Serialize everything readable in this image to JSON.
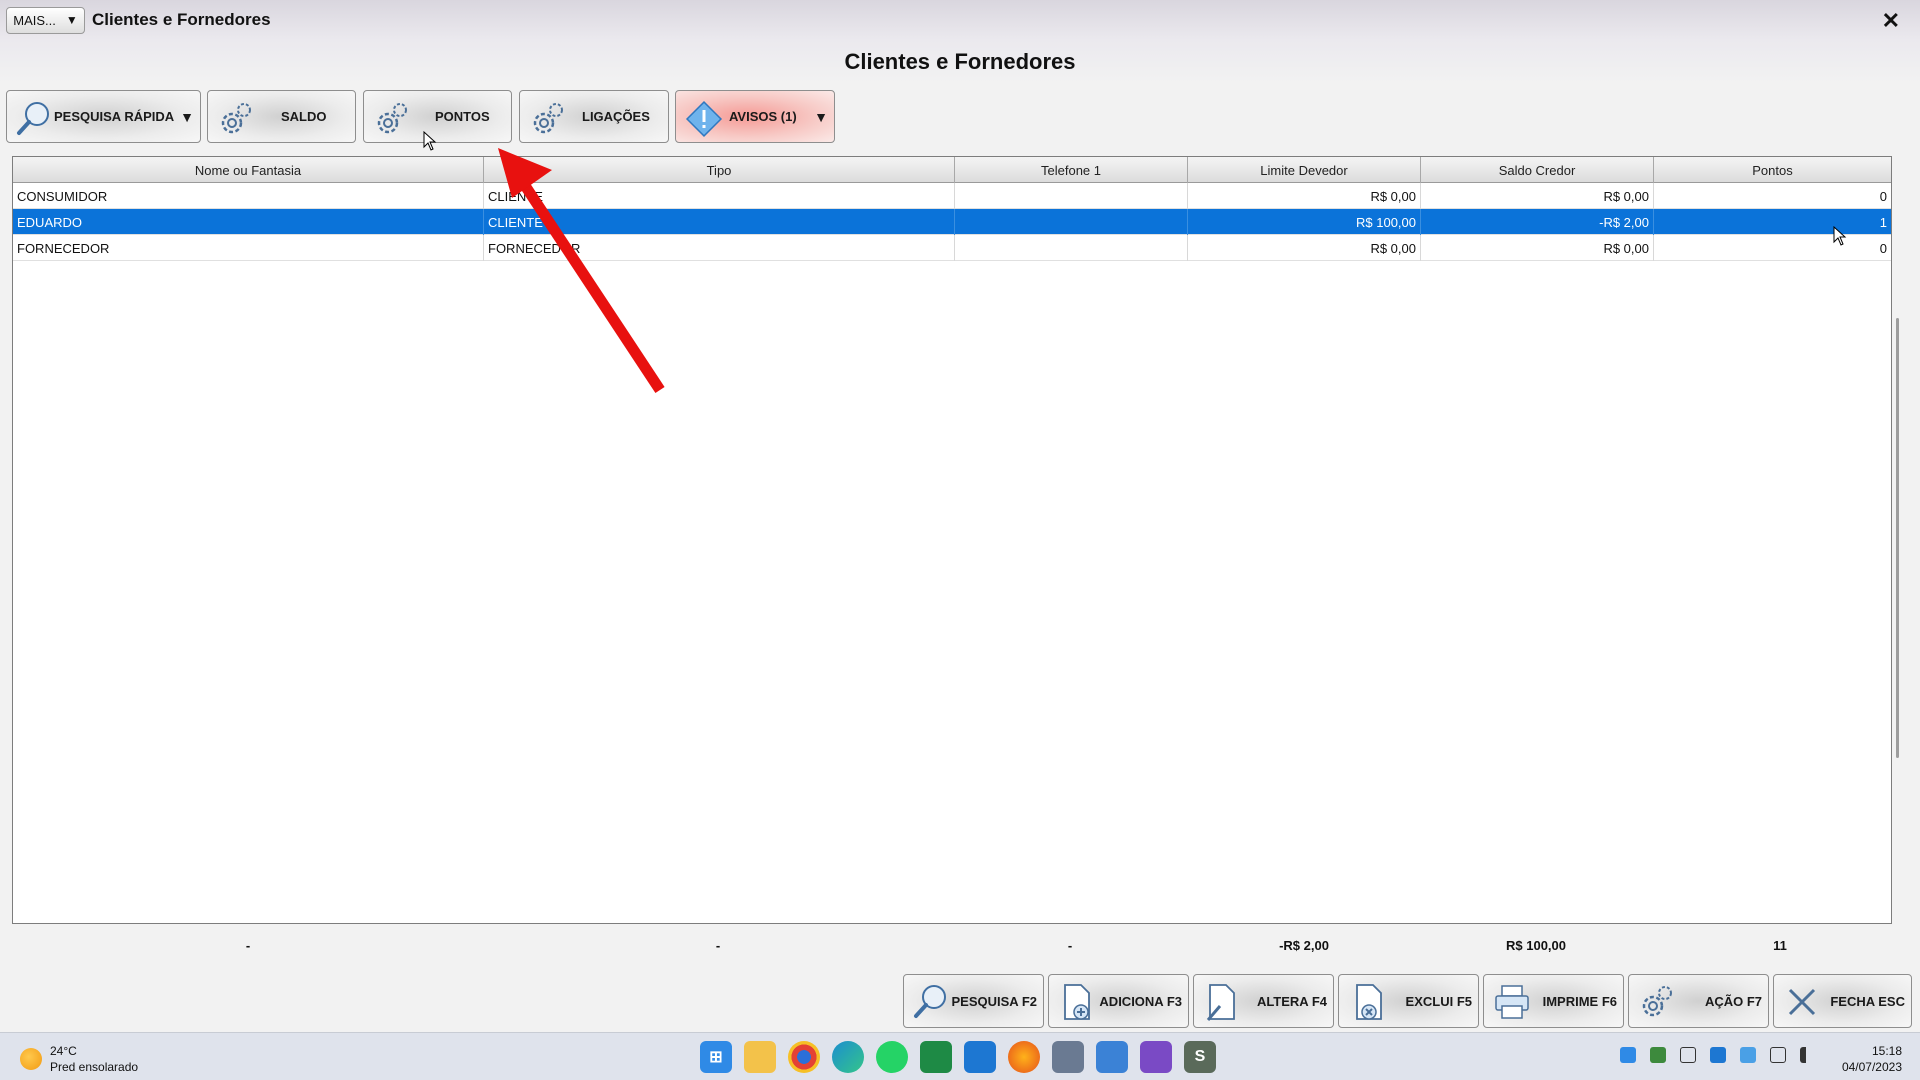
{
  "window": {
    "mais_label": "MAIS...",
    "title": "Clientes e Fornedores",
    "close_glyph": "✕",
    "page_title": "Clientes e Fornedores"
  },
  "toolbar": {
    "quick_search": "PESQUISA RÁPIDA",
    "saldo": "SALDO",
    "pontos": "PONTOS",
    "ligacoes": "LIGAÇÕES",
    "avisos": "AVISOS (1)",
    "dropdown_glyph": "▼"
  },
  "grid": {
    "columns": [
      "Nome ou Fantasia",
      "Tipo",
      "Telefone 1",
      "Limite Devedor",
      "Saldo Credor",
      "Pontos"
    ],
    "rows": [
      {
        "nome": "CONSUMIDOR",
        "tipo": "CLIENTE",
        "telefone": "",
        "limite": "R$ 0,00",
        "saldo": "R$ 0,00",
        "pontos": "0"
      },
      {
        "nome": "EDUARDO",
        "tipo": "CLIENTE",
        "telefone": "",
        "limite": "R$ 100,00",
        "saldo": "-R$ 2,00",
        "pontos": "1"
      },
      {
        "nome": "FORNECEDOR",
        "tipo": "FORNECEDOR",
        "telefone": "",
        "limite": "R$ 0,00",
        "saldo": "R$ 0,00",
        "pontos": "0"
      }
    ],
    "selected_row": 1
  },
  "totals": {
    "nome": "-",
    "tipo": "-",
    "telefone": "-",
    "limite": "-R$ 2,00",
    "saldo": "R$ 100,00",
    "pontos": "11"
  },
  "bottom_buttons": {
    "pesquisa": "PESQUISA F2",
    "adiciona": "ADICIONA F3",
    "altera": "ALTERA F4",
    "exclui": "EXCLUI F5",
    "imprime": "IMPRIME F6",
    "acao": "AÇÃO F7",
    "fecha": "FECHA ESC"
  },
  "taskbar": {
    "temperature": "24°C",
    "weather_desc": "Pred ensolarado",
    "time": "15:18",
    "date": "04/07/2023",
    "apps": [
      "windows-start",
      "file-explorer",
      "chrome",
      "edge",
      "whatsapp",
      "spreadsheet",
      "mail",
      "firefox",
      "settings",
      "notepad",
      "video",
      "app-s"
    ]
  },
  "colors": {
    "selection": "#0b73d9",
    "alert_button": "#f59a95",
    "arrow": "#e8110f"
  }
}
